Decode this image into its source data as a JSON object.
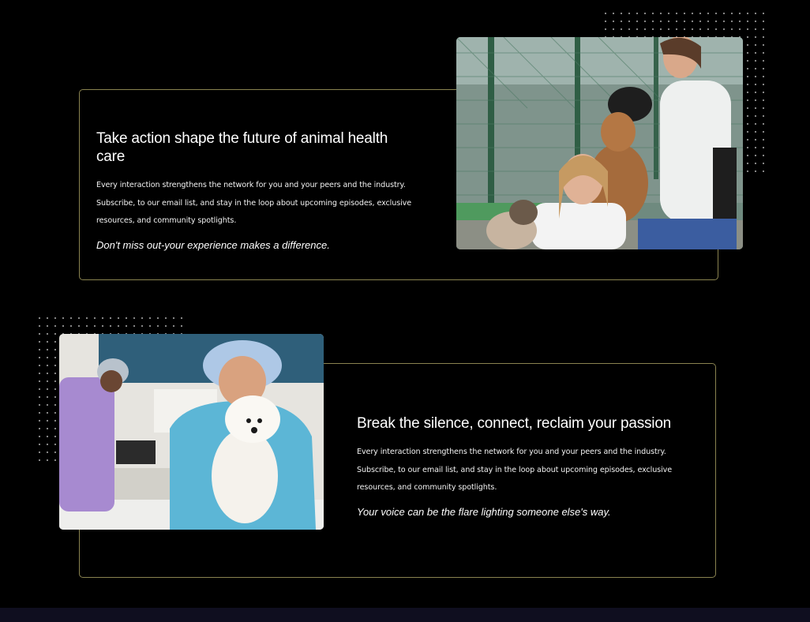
{
  "sections": [
    {
      "heading": "Take action shape the future of animal health care",
      "body": "Every interaction strengthens the network for you and your peers and the industry. Subscribe, to our email list, and stay in the loop about upcoming episodes, exclusive resources, and community spotlights.",
      "tagline": "Don't miss out-your experience makes a difference.",
      "image": "volunteers-with-dogs-photo"
    },
    {
      "heading": "Break the silence, connect, reclaim your passion",
      "body": "Every interaction strengthens the network for you and your peers and the industry. Subscribe, to our email list, and stay in the loop about upcoming episodes, exclusive resources, and community spotlights.",
      "tagline": "Your voice can be the flare lighting someone else's way.",
      "image": "vet-holding-dog-photo"
    }
  ],
  "colors": {
    "background": "#000000",
    "card_border": "#8a8350",
    "footer_band": "#0f0e1f",
    "text": "#ffffff"
  }
}
